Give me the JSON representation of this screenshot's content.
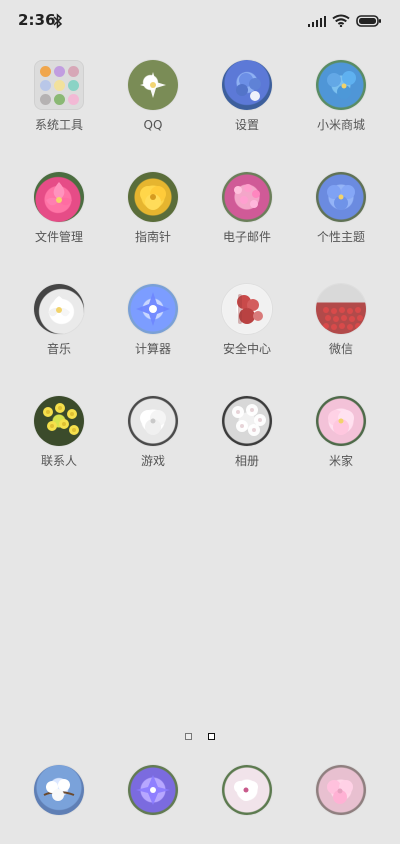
{
  "status": {
    "time": "2:36",
    "bluetooth": "bluetooth-icon",
    "signal": "signal-bars-icon",
    "wifi": "wifi-icon",
    "battery": "battery-icon"
  },
  "apps": [
    {
      "label": "系统工具",
      "icon": "folder-icon"
    },
    {
      "label": "QQ",
      "icon": "qq-icon"
    },
    {
      "label": "设置",
      "icon": "settings-icon"
    },
    {
      "label": "小米商城",
      "icon": "mi-store-icon"
    },
    {
      "label": "文件管理",
      "icon": "file-manager-icon"
    },
    {
      "label": "指南针",
      "icon": "compass-icon"
    },
    {
      "label": "电子邮件",
      "icon": "email-icon"
    },
    {
      "label": "个性主题",
      "icon": "themes-icon"
    },
    {
      "label": "音乐",
      "icon": "music-icon"
    },
    {
      "label": "计算器",
      "icon": "calculator-icon"
    },
    {
      "label": "安全中心",
      "icon": "security-icon"
    },
    {
      "label": "微信",
      "icon": "wechat-icon"
    },
    {
      "label": "联系人",
      "icon": "contacts-icon"
    },
    {
      "label": "游戏",
      "icon": "games-icon"
    },
    {
      "label": "相册",
      "icon": "gallery-icon"
    },
    {
      "label": "米家",
      "icon": "mijia-icon"
    }
  ],
  "dock": [
    {
      "icon": "phone-icon"
    },
    {
      "icon": "messages-icon"
    },
    {
      "icon": "browser-icon"
    },
    {
      "icon": "camera-icon"
    }
  ],
  "pages": {
    "count": 2,
    "active": 1
  },
  "colors": {
    "background": "#e6e6e6",
    "label": "#555555"
  }
}
